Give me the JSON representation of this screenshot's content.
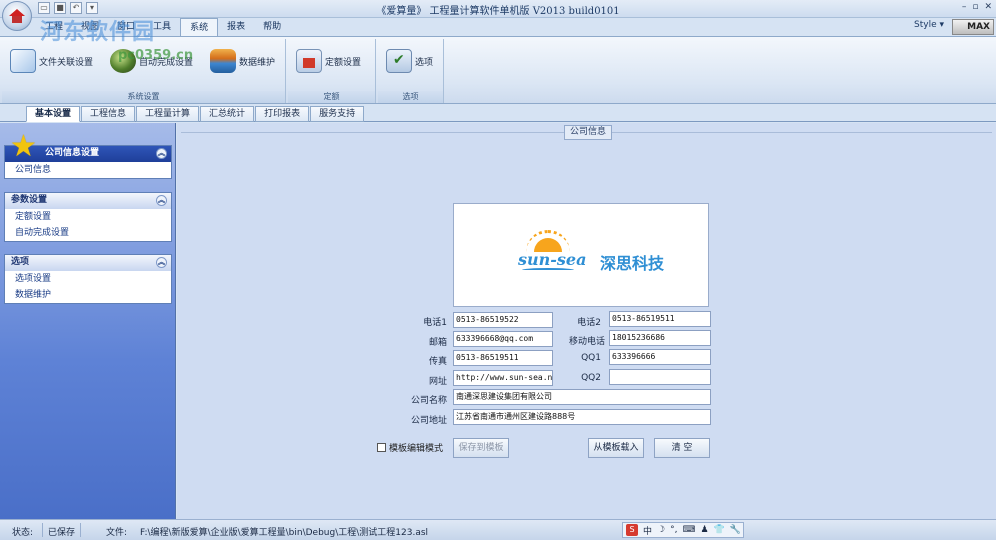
{
  "window": {
    "title": "《爱算量》 工程量计算软件单机版 V2013 build0101",
    "style_menu": "Style ▾",
    "max_badge": "MAX",
    "controls": [
      "–",
      "▫",
      "✕"
    ]
  },
  "watermark": {
    "site": "河东软件园",
    "url": "pc0359.cn"
  },
  "ribbon_tabs": [
    "工程",
    "视图",
    "窗口",
    "工具",
    "系统",
    "报表",
    "帮助"
  ],
  "ribbon_active_tab": "系统",
  "ribbon": {
    "groups": [
      {
        "label": "系统设置",
        "buttons": [
          "文件关联设置",
          "自动完成设置",
          "数据维护"
        ]
      },
      {
        "label": "定额",
        "buttons": [
          "定额设置"
        ]
      },
      {
        "label": "选项",
        "buttons": [
          "选项"
        ]
      }
    ]
  },
  "subtabs": [
    "基本设置",
    "工程信息",
    "工程量计算",
    "汇总统计",
    "打印报表",
    "服务支持"
  ],
  "active_subtab": "基本设置",
  "leftnav": {
    "groups": [
      {
        "title": "公司信息设置",
        "items": [
          "公司信息"
        ]
      },
      {
        "title": "参数设置",
        "items": [
          "定额设置",
          "自动完成设置"
        ]
      },
      {
        "title": "选项",
        "items": [
          "选项设置",
          "数据维护"
        ]
      }
    ]
  },
  "main": {
    "section_title": "公司信息",
    "logo": {
      "en": "sun-sea",
      "cn": "深思科技"
    },
    "fields": {
      "phone1": {
        "label": "电话1",
        "value": "0513-86519522"
      },
      "phone2": {
        "label": "电话2",
        "value": "0513-86519511"
      },
      "email": {
        "label": "邮箱",
        "value": "633396668@qq.com"
      },
      "mobile": {
        "label": "移动电话",
        "value": "18015236686"
      },
      "fax": {
        "label": "传真",
        "value": "0513-86519511"
      },
      "qq1": {
        "label": "QQ1",
        "value": "633396666"
      },
      "website": {
        "label": "网址",
        "value": "http://www.sun-sea.net"
      },
      "qq2": {
        "label": "QQ2",
        "value": ""
      },
      "company_name": {
        "label": "公司名称",
        "value": "南通深思建设集团有限公司"
      },
      "company_address": {
        "label": "公司地址",
        "value": "江苏省南通市通州区建设路888号"
      }
    },
    "template_edit_mode": "模板编辑模式",
    "save_to_template": "保存到模板",
    "load_from_template": "从模板载入",
    "clear": "清 空"
  },
  "statusbar": {
    "status_label": "状态:",
    "status_value": "已保存",
    "file_label": "文件:",
    "file_path": "F:\\编程\\新版爱算\\企业版\\爱算工程量\\bin\\Debug\\工程\\测试工程123.asl",
    "ime": [
      "S",
      "中",
      "☽",
      "°,",
      "⌨",
      "♟",
      "👕",
      "🔧"
    ]
  }
}
